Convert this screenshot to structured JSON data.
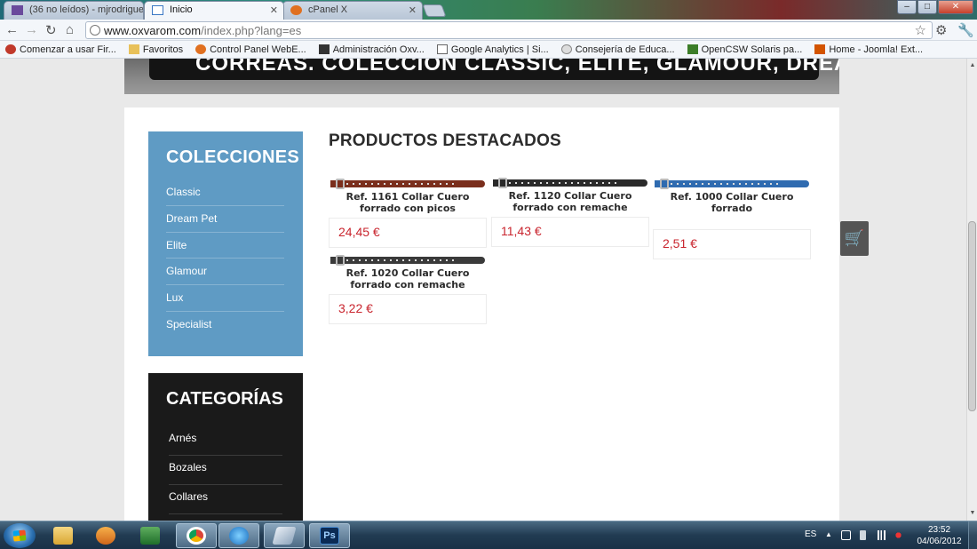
{
  "browser": {
    "tabs": [
      {
        "label": "(36 no leídos) - mjrodrigue"
      },
      {
        "label": "Inicio"
      },
      {
        "label": "cPanel X"
      }
    ],
    "url_main": "www.oxvarom.com",
    "url_rest": "/index.php?lang=es"
  },
  "bookmarks": [
    {
      "label": "Comenzar a usar Fir..."
    },
    {
      "label": "Favoritos"
    },
    {
      "label": "Control Panel WebE..."
    },
    {
      "label": "Administración Oxv..."
    },
    {
      "label": "Google Analytics | Si..."
    },
    {
      "label": "Consejería de Educa..."
    },
    {
      "label": "OpenCSW Solaris pa..."
    },
    {
      "label": "Home - Joomla! Ext..."
    }
  ],
  "banner": {
    "text": "CORREAS. COLECCIÓN CLASSIC, ELITE, GLAMOUR, DREAM..."
  },
  "colecciones": {
    "title": "COLECCIONES",
    "items": [
      "Classic",
      "Dream Pet",
      "Elite",
      "Glamour",
      "Lux",
      "Specialist"
    ]
  },
  "categorias": {
    "title": "CATEGORÍAS",
    "items": [
      "Arnés",
      "Bozales",
      "Collares"
    ]
  },
  "featured": {
    "title": "PRODUCTOS DESTACADOS",
    "products": [
      {
        "name": "Ref. 1161 Collar Cuero forrado con picos",
        "price": "24,45 €",
        "color": "#7a2e1c"
      },
      {
        "name": "Ref. 1120 Collar Cuero forrado con remache",
        "price": "11,43 €",
        "color": "#2a2a2a"
      },
      {
        "name": "Ref. 1000 Collar Cuero forrado",
        "price": "2,51 €",
        "color": "#2f6bb0"
      },
      {
        "name": "Ref. 1020 Collar Cuero forrado con remache",
        "price": "3,22 €",
        "color": "#3a3a3a"
      }
    ]
  },
  "taskbar": {
    "language": "ES",
    "time": "23:52",
    "date": "04/06/2012"
  },
  "colors": {
    "price_red": "#c9252e",
    "sidebar_blue": "#5f9bc4",
    "categories_black": "#1a1a1a"
  }
}
